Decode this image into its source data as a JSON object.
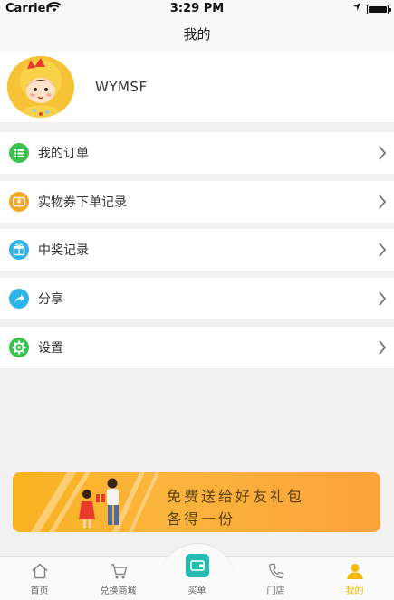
{
  "status_bar": {
    "carrier": "Carrier",
    "time": "3:29 PM"
  },
  "nav": {
    "title": "我的"
  },
  "profile": {
    "username": "WYMSF"
  },
  "menu": [
    {
      "label": "我的订单",
      "icon": "list-icon",
      "color": "#3cc24c"
    },
    {
      "label": "实物券下单记录",
      "icon": "coupon-icon",
      "color": "#f5a623"
    },
    {
      "label": "中奖记录",
      "icon": "gift-icon",
      "color": "#2bb5e8"
    },
    {
      "label": "分享",
      "icon": "share-icon",
      "color": "#2bb5e8"
    },
    {
      "label": "设置",
      "icon": "gear-icon",
      "color": "#3cc24c"
    }
  ],
  "banner": {
    "line1": "免费送给好友礼包",
    "line2": "各得一份"
  },
  "tabs": [
    {
      "label": "首页",
      "icon": "home-icon"
    },
    {
      "label": "兑换商城",
      "icon": "cart-icon"
    },
    {
      "label": "买单",
      "icon": "wallet-icon"
    },
    {
      "label": "门店",
      "icon": "phone-icon"
    },
    {
      "label": "我的",
      "icon": "user-icon"
    }
  ],
  "colors": {
    "accent": "#f5b800",
    "teal": "#25bcb0",
    "banner": "#f9b21f"
  }
}
